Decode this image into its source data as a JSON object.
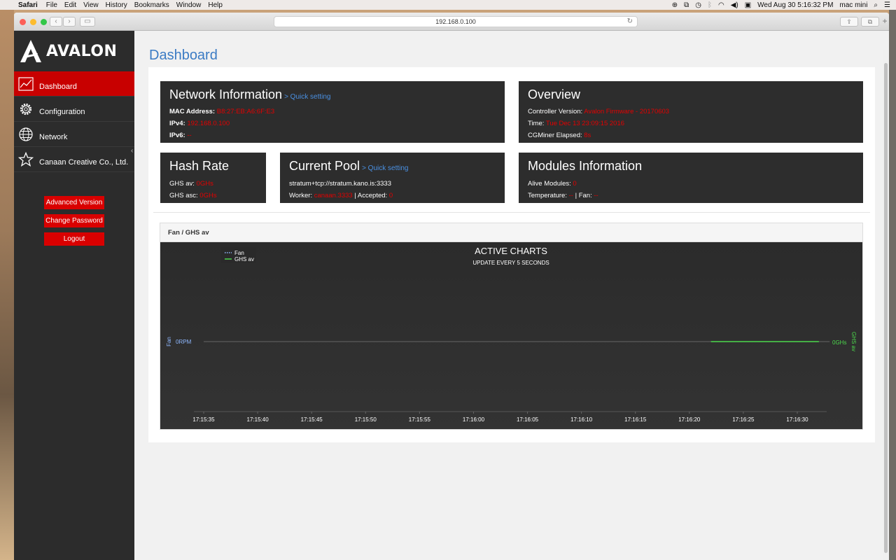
{
  "menubar": {
    "app": "Safari",
    "items": [
      "File",
      "Edit",
      "View",
      "History",
      "Bookmarks",
      "Window",
      "Help"
    ],
    "datetime": "Wed Aug 30  5:16:32 PM",
    "user": "mac mini"
  },
  "browser": {
    "url": "192.168.0.100"
  },
  "sidebar": {
    "logo": "AVALON",
    "items": [
      {
        "label": "Dashboard",
        "icon": "chart-line-icon"
      },
      {
        "label": "Configuration",
        "icon": "gear-icon"
      },
      {
        "label": "Network",
        "icon": "globe-icon"
      },
      {
        "label": "Canaan Creative Co., Ltd.",
        "icon": "star-icon"
      }
    ],
    "buttons": {
      "advanced": "Advanced Version",
      "password": "Change Password",
      "logout": "Logout"
    }
  },
  "page": {
    "title": "Dashboard"
  },
  "network": {
    "title": "Network Information",
    "quick": "> Quick setting",
    "mac_label": "MAC Address:",
    "mac": "B8:27:EB:A6:6F:E3",
    "ipv4_label": "IPv4:",
    "ipv4": "192.168.0.100",
    "ipv6_label": "IPv6:",
    "ipv6": "--"
  },
  "overview": {
    "title": "Overview",
    "ver_label": "Controller Version:",
    "ver": "Avalon Firmware - 20170603",
    "time_label": "Time:",
    "time": "Tue Dec 13 23:09:15 2016",
    "elapsed_label": "CGMiner Elapsed:",
    "elapsed": "8s"
  },
  "hashrate": {
    "title": "Hash Rate",
    "av_label": "GHS av:",
    "av": "0GHs",
    "asc_label": "GHS asc:",
    "asc": "0GHs"
  },
  "pool": {
    "title": "Current Pool",
    "quick": "> Quick setting",
    "url": "stratum+tcp://stratum.kano.is:3333",
    "worker_label": "Worker:",
    "worker": "canaan.3333",
    "accepted_label": "| Accepted:",
    "accepted": "0"
  },
  "modules": {
    "title": "Modules Information",
    "alive_label": "Alive Modules:",
    "alive": "0",
    "temp_label": "Temperature:",
    "temp": "--",
    "fan_label": "| Fan:",
    "fan": "--"
  },
  "chart": {
    "header": "Fan / GHS av",
    "title": "ACTIVE CHARTS",
    "subtitle": "UPDATE EVERY 5 SECONDS",
    "left_axis": "Fan",
    "right_axis": "GHS av",
    "left_value": "0RPM",
    "right_value": "0GHs"
  },
  "chart_data": {
    "type": "line",
    "title": "ACTIVE CHARTS",
    "subtitle": "UPDATE EVERY 5 SECONDS",
    "x": [
      "17:15:35",
      "17:15:40",
      "17:15:45",
      "17:15:50",
      "17:15:55",
      "17:16:00",
      "17:16:05",
      "17:16:10",
      "17:16:15",
      "17:16:20",
      "17:16:25",
      "17:16:30"
    ],
    "series": [
      {
        "name": "Fan",
        "color": "#8fb8ff",
        "style": "dotted",
        "axis": "left",
        "unit": "RPM",
        "points": [
          [
            "17:15:35",
            0
          ],
          [
            "17:16:33",
            0
          ]
        ]
      },
      {
        "name": "GHS av",
        "color": "#4cd94c",
        "style": "solid",
        "axis": "right",
        "unit": "GHs",
        "points": [
          [
            "17:16:22",
            0
          ],
          [
            "17:16:32",
            0
          ]
        ]
      }
    ],
    "ylabel_left": "Fan",
    "ylabel_right": "GHS av",
    "legend": "top-left"
  }
}
